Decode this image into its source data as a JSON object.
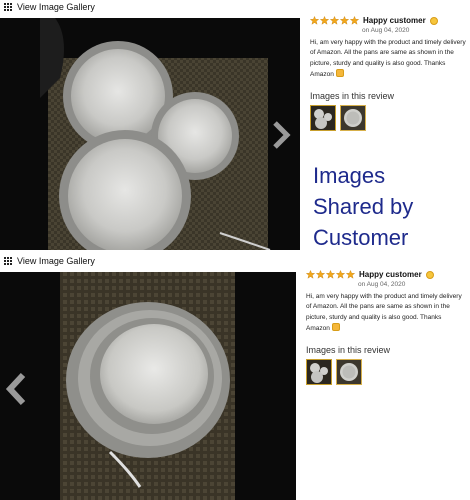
{
  "panels": [
    {
      "gallery_link": "View Image Gallery",
      "review": {
        "rating": 5,
        "title": "Happy customer",
        "date": "on Aug 04, 2020",
        "body": "Hi, am very happy with the product and timely delivery of Amazon. All the pans are same as shown in the picture, sturdy and quality is also good. Thanks Amazon",
        "images_heading": "Images in this review"
      }
    },
    {
      "gallery_link": "View Image Gallery",
      "review": {
        "rating": 5,
        "title": "Happy customer",
        "date": "on Aug 04, 2020",
        "body": "Hi, am very happy with the product and timely delivery of Amazon. All the pans are same as shown in the picture, sturdy and quality is also good. Thanks Amazon",
        "images_heading": "Images in this review"
      }
    }
  ],
  "caption": [
    "Images",
    "Shared by",
    "Customer"
  ],
  "icons": {
    "grid": "grid-icon",
    "next": "chevron-right-icon",
    "prev": "chevron-left-icon",
    "star": "star-icon",
    "smile": "smiley-emoji-icon",
    "thumbs_up": "thumbs-up-emoji-icon"
  },
  "colors": {
    "star": "#f2a71b",
    "caption": "#1e2a8c",
    "thumb_border": "#c89f2c"
  }
}
